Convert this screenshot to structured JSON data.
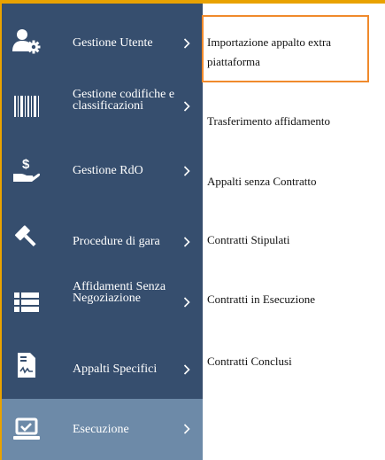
{
  "colors": {
    "sidebar_bg": "#364e6e",
    "active_bg": "#6d8aa8",
    "highlight_border": "#f08a2c",
    "top_border": "#e9a200"
  },
  "sidebar": {
    "items": [
      {
        "label": "Gestione Utente",
        "icon": "user-gear-icon"
      },
      {
        "label": "Gestione codifiche e classificazioni",
        "icon": "barcode-icon"
      },
      {
        "label": "Gestione RdO",
        "icon": "hand-money-icon"
      },
      {
        "label": "Procedure di gara",
        "icon": "gavel-icon"
      },
      {
        "label": "Affidamenti Senza Negoziazione",
        "icon": "list-icon"
      },
      {
        "label": "Appalti Specifici",
        "icon": "document-signature-icon"
      },
      {
        "label": "Esecuzione",
        "icon": "laptop-check-icon",
        "active": true
      }
    ]
  },
  "submenu": {
    "items": [
      {
        "label": "Importazione appalto extra piattaforma",
        "highlighted": true
      },
      {
        "label": "Trasferimento affidamento"
      },
      {
        "label": "Appalti senza Contratto"
      },
      {
        "label": "Contratti Stipulati"
      },
      {
        "label": "Contratti in Esecuzione"
      },
      {
        "label": "Contratti Conclusi"
      }
    ]
  }
}
